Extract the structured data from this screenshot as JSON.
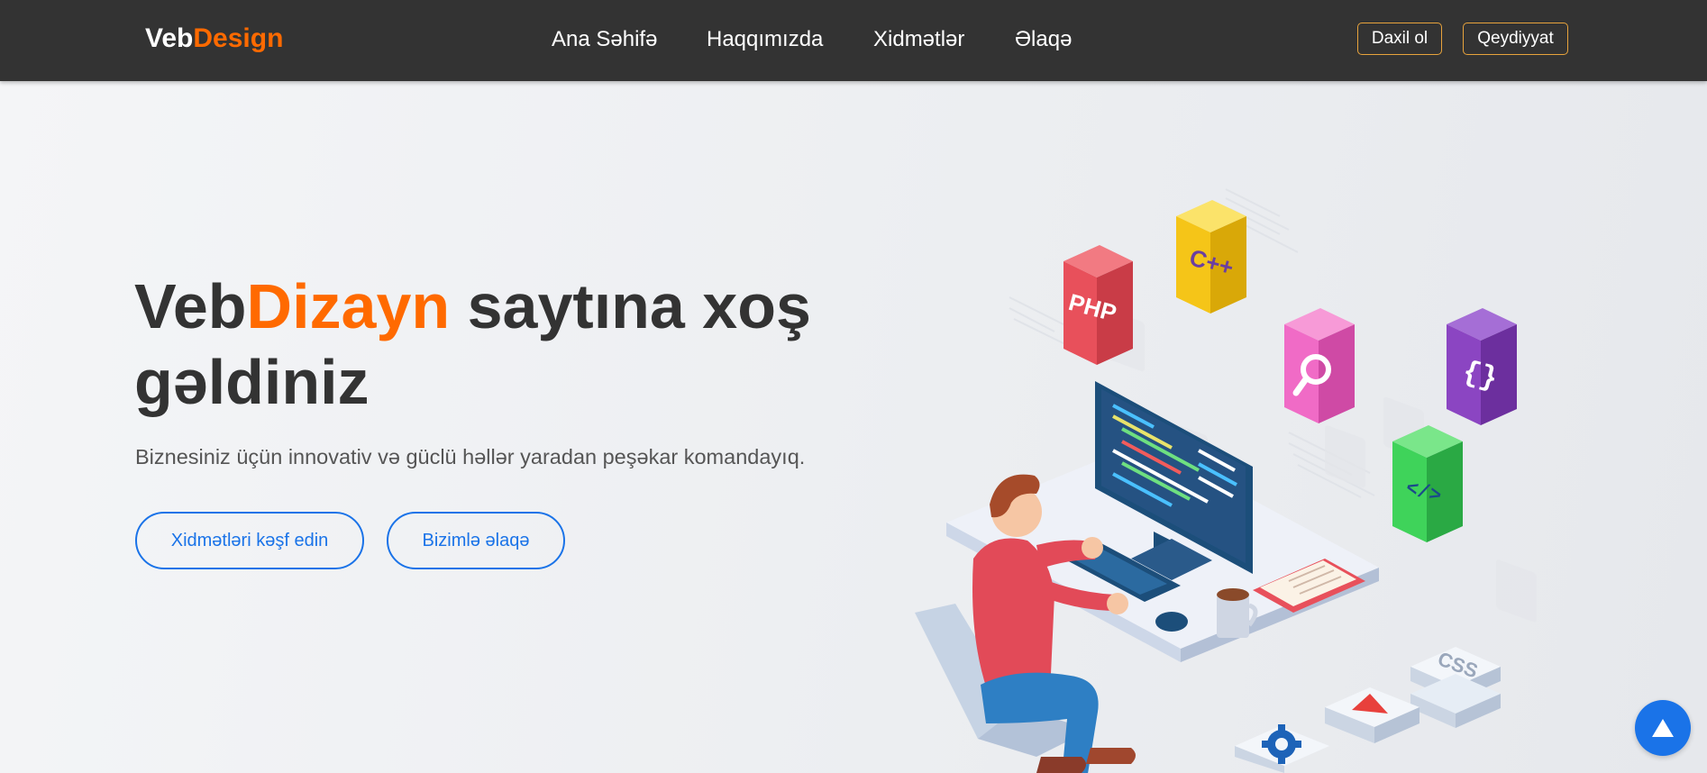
{
  "navbar": {
    "logo_part1": "Veb",
    "logo_part2": "Design",
    "links": [
      {
        "label": "Ana Səhifə"
      },
      {
        "label": "Haqqımızda"
      },
      {
        "label": "Xidmətlər"
      },
      {
        "label": "Əlaqə"
      }
    ],
    "login_label": "Daxil ol",
    "register_label": "Qeydiyyat"
  },
  "hero": {
    "title_part1": "Veb",
    "title_accent": "Dizayn",
    "title_part2": " saytına xoş gəldiniz",
    "subtitle": "Biznesiniz üçün innovativ və güclü həllər yaradan peşəkar komandayıq.",
    "primary_button": "Xidmətləri kəşf edin",
    "secondary_button": "Bizimlə əlaqə"
  },
  "illustration": {
    "tiles": [
      {
        "icon": "php-icon",
        "text": "PHP",
        "color": "#e8505b"
      },
      {
        "icon": "cpp-icon",
        "text": "C++",
        "color": "#f5c518"
      },
      {
        "icon": "search-icon",
        "text": "",
        "color": "#f06bc6"
      },
      {
        "icon": "braces-icon",
        "text": "{ }",
        "color": "#8b45c2"
      },
      {
        "icon": "code-icon",
        "text": "</>",
        "color": "#3fd35a"
      },
      {
        "icon": "css-icon",
        "text": "CSS",
        "color": "#e6edf5"
      }
    ]
  },
  "colors": {
    "navbar_bg": "#333333",
    "accent_orange": "#ff6a00",
    "accent_blue": "#1a73e8",
    "button_border": "#e8a33c"
  },
  "scroll_top_icon": "arrow-up-icon"
}
